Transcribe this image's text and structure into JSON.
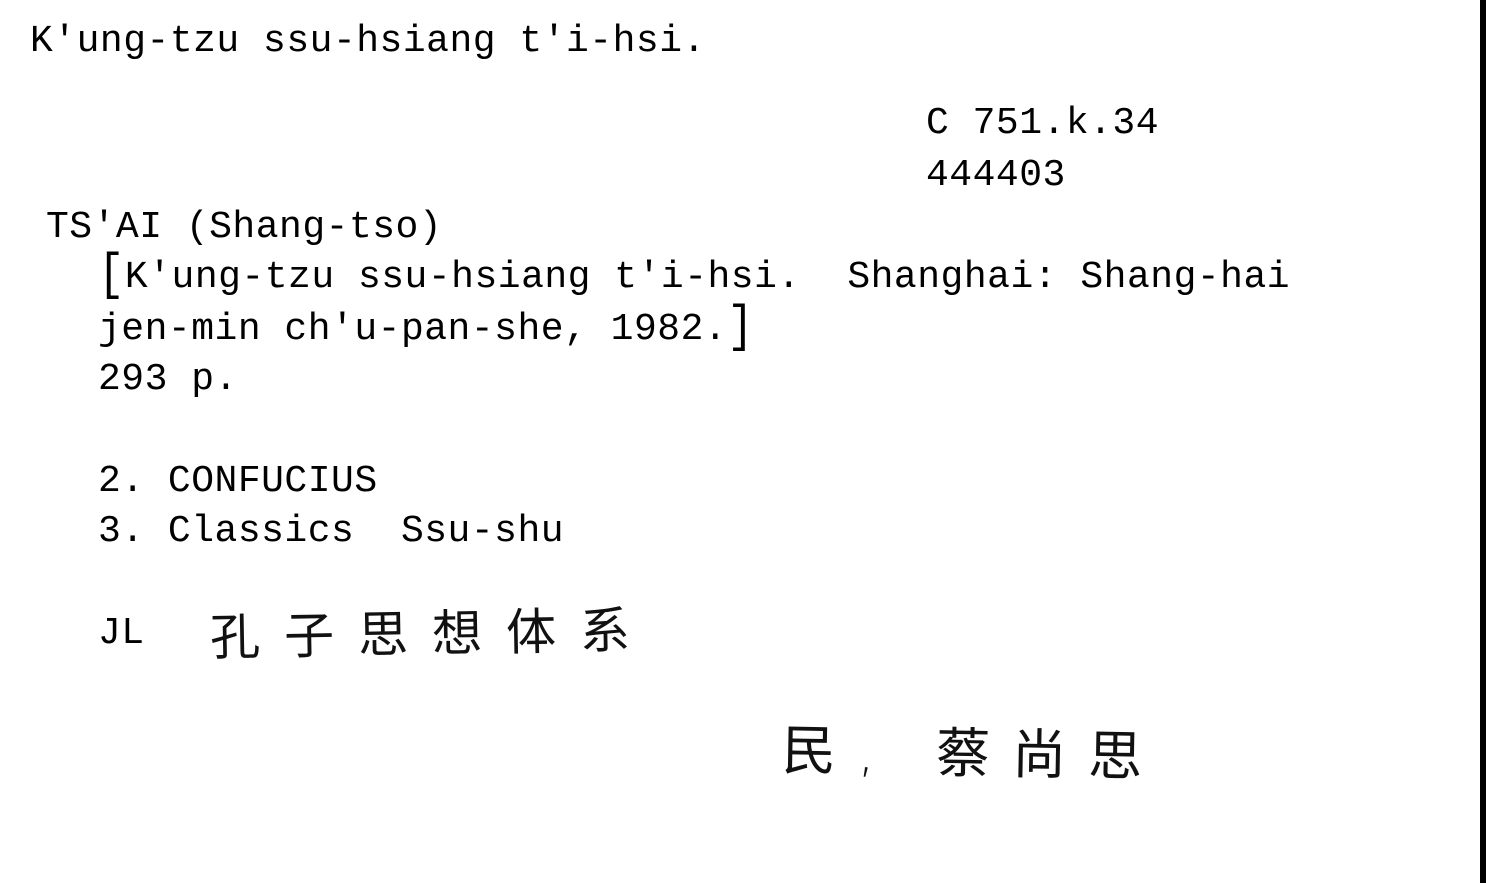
{
  "card": {
    "heading": "K'ung-tzu ssu-hsiang t'i-hsi.",
    "shelfmark": "C 751.k.34",
    "accession": "444403",
    "author": "TS'AI (Shang-tso)",
    "imprint_line1": "K'ung-tzu ssu-hsiang t'i-hsi.  Shanghai: Shang-hai",
    "imprint_line2": "jen-min ch'u-pan-she, 1982.",
    "collation": "293 p.",
    "subject_2": "2. CONFUCIUS",
    "subject_3": "3. Classics  Ssu-shu",
    "cataloguer_initials": "JL",
    "handwritten_title": "孔子思想体系",
    "handwritten_author": "民, 蔡尚思"
  },
  "brackets": {
    "open": "[",
    "close": "]"
  }
}
